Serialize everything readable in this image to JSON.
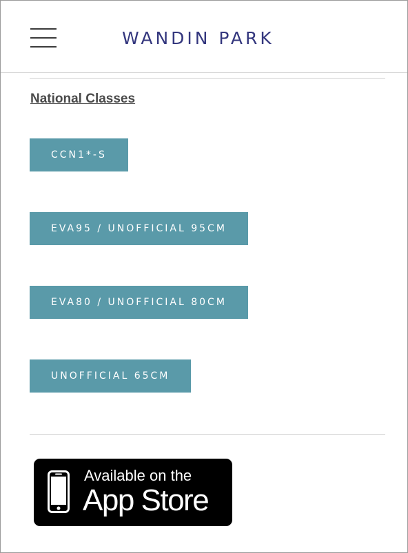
{
  "header": {
    "title": "WANDIN PARK",
    "menu_icon": "hamburger-menu-icon"
  },
  "section": {
    "heading": "National Classes"
  },
  "classes": [
    {
      "label": "CCN1*-S"
    },
    {
      "label": "EVA95 / UNOFFICIAL 95CM"
    },
    {
      "label": "EVA80 / UNOFFICIAL 80CM"
    },
    {
      "label": "UNOFFICIAL 65CM"
    }
  ],
  "app_store": {
    "line1": "Available on the",
    "line2": "App Store",
    "icon": "phone-icon"
  },
  "colors": {
    "title": "#34377e",
    "button_bg": "#5a9aa9",
    "heading": "#4a4a4a"
  }
}
